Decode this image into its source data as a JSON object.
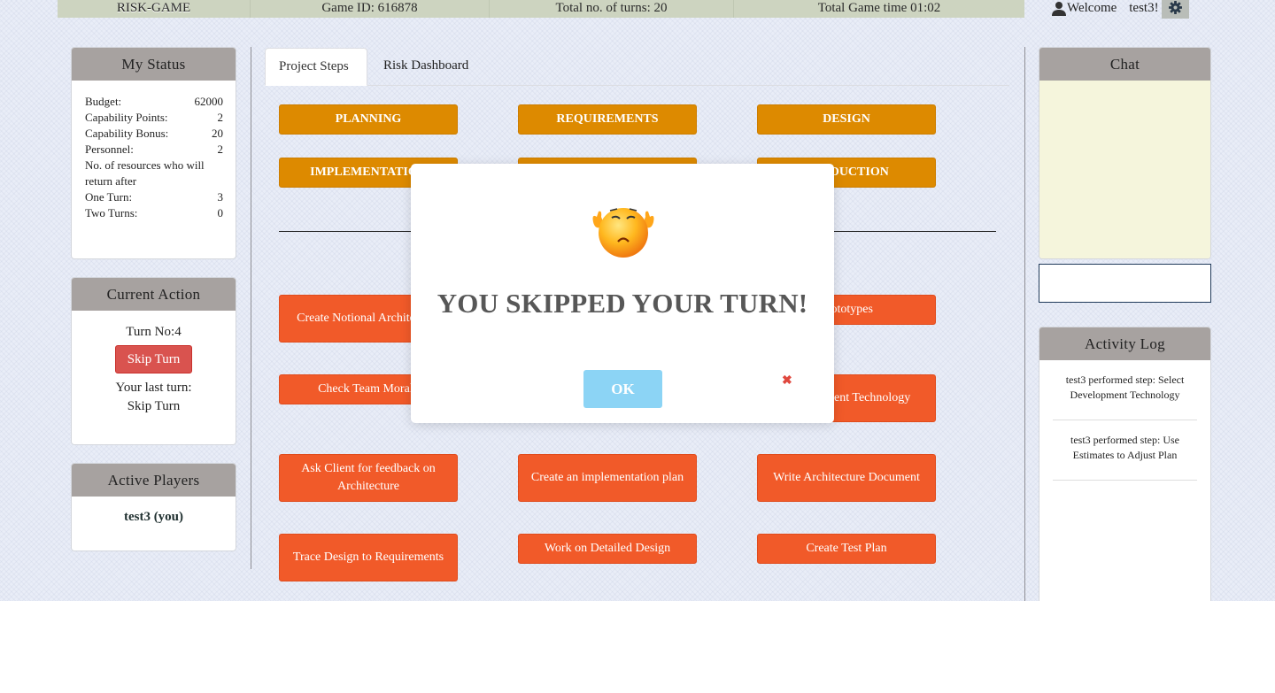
{
  "topbar": {
    "app_name": "RISK-GAME",
    "game_id": "Game ID: 616878",
    "total_turns": "Total no. of turns: 20",
    "total_time": "Total Game time 01:02"
  },
  "user": {
    "welcome": "Welcome",
    "name": "test3!"
  },
  "my_status": {
    "title": "My Status",
    "rows": [
      {
        "label": "Budget:",
        "value": "62000"
      },
      {
        "label": "Capability Points:",
        "value": "2"
      },
      {
        "label": "Capability Bonus:",
        "value": "20"
      },
      {
        "label": "Personnel:",
        "value": "2"
      }
    ],
    "resources_label": "No. of resources who will return after",
    "return_rows": [
      {
        "label": "One Turn:",
        "value": "3"
      },
      {
        "label": "Two Turns:",
        "value": "0"
      }
    ]
  },
  "current_action": {
    "title": "Current Action",
    "turn_label": "Turn No:",
    "turn_no": "4",
    "skip_button": "Skip Turn",
    "last_turn_label": "Your last turn:",
    "last_turn_value": "Skip Turn"
  },
  "active_players": {
    "title": "Active Players",
    "players": [
      "test3 (you)"
    ]
  },
  "tabs": [
    {
      "label": "Project Steps",
      "active": true
    },
    {
      "label": "Risk Dashboard",
      "active": false
    }
  ],
  "phases": [
    "PLANNING",
    "REQUIREMENTS",
    "DESIGN",
    "IMPLEMENTATION",
    "",
    "PRODUCTION"
  ],
  "steps": [
    "Create Notional Architecture",
    "",
    "Prototypes",
    "Check Team Morale",
    "",
    "Development Technology",
    "Ask Client for feedback on Architecture",
    "Create an implementation plan",
    "Write Architecture Document",
    "Trace Design to Requirements",
    "Work on Detailed Design",
    "Create Test Plan"
  ],
  "chat": {
    "title": "Chat",
    "input_value": ""
  },
  "activity_log": {
    "title": "Activity Log",
    "entries": [
      "test3 performed step: Select Development Technology",
      "test3 performed step: Use Estimates to Adjust Plan"
    ]
  },
  "modal": {
    "message": "YOU SKIPPED YOUR TURN!",
    "ok_label": "OK",
    "close_symbol": "✖"
  },
  "colors": {
    "phase_button": "#dd8a00",
    "step_button": "#f15a29",
    "panel_header": "#a7a2a0",
    "skip_button": "#d9534f",
    "ok_button": "#8cd4f5",
    "chat_bg": "#f5f5dc",
    "topbar": "#cdd4c0"
  },
  "icons": [
    "user-icon",
    "gear-icon",
    "sad-emoji-icon",
    "close-icon"
  ]
}
